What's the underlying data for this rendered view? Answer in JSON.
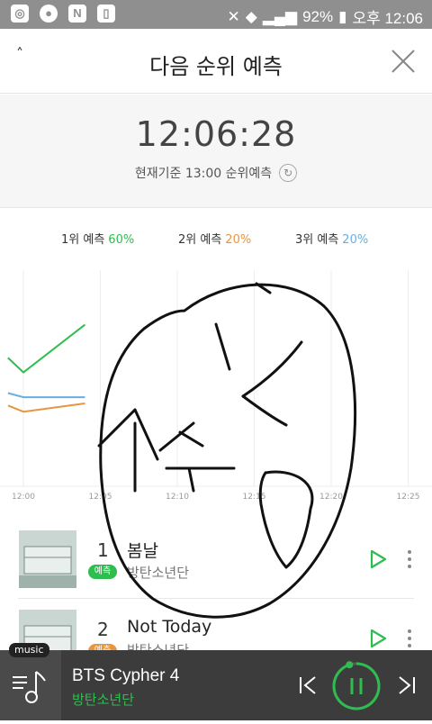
{
  "status_bar": {
    "battery": "92%",
    "time": "오후 12:06"
  },
  "header": {
    "title": "다음 순위 예측",
    "back_icon": "chevron-up-icon",
    "close_icon": "close-icon"
  },
  "clock": {
    "time": "12:06:28",
    "basis": "현재기준 13:00 순위예측"
  },
  "legend": [
    {
      "label": "1위 예측",
      "pct": "60%",
      "color": "#2ebd4f"
    },
    {
      "label": "2위 예측",
      "pct": "20%",
      "color": "#e89540"
    },
    {
      "label": "3위 예측",
      "pct": "20%",
      "color": "#6aaee0"
    }
  ],
  "chart_data": {
    "type": "line",
    "x": [
      "12:00",
      "12:05",
      "12:10",
      "12:15",
      "12:20",
      "12:25"
    ],
    "ylim": [
      0,
      100
    ],
    "grid": true,
    "series": [
      {
        "name": "1위 예측",
        "color": "#2ebd4f",
        "points": [
          [
            "11:59",
            62
          ],
          [
            "12:00",
            55
          ],
          [
            "12:04",
            78
          ]
        ]
      },
      {
        "name": "2위 예측",
        "color": "#e89540",
        "points": [
          [
            "11:59",
            39
          ],
          [
            "12:00",
            36
          ],
          [
            "12:04",
            40
          ]
        ]
      },
      {
        "name": "3위 예측",
        "color": "#6aaee0",
        "points": [
          [
            "11:59",
            45
          ],
          [
            "12:00",
            43
          ],
          [
            "12:04",
            43
          ]
        ]
      }
    ]
  },
  "tracks": [
    {
      "rank": "1",
      "badge": "예측",
      "badge_color": "#2ebd4f",
      "title": "봄날",
      "artist": "방탄소년단"
    },
    {
      "rank": "2",
      "badge": "예측",
      "badge_color": "#e89540",
      "title": "Not Today",
      "artist": "방탄소년단"
    }
  ],
  "player": {
    "tag": "music",
    "title": "BTS Cypher 4",
    "artist": "방탄소년단",
    "progress": 0.95
  }
}
